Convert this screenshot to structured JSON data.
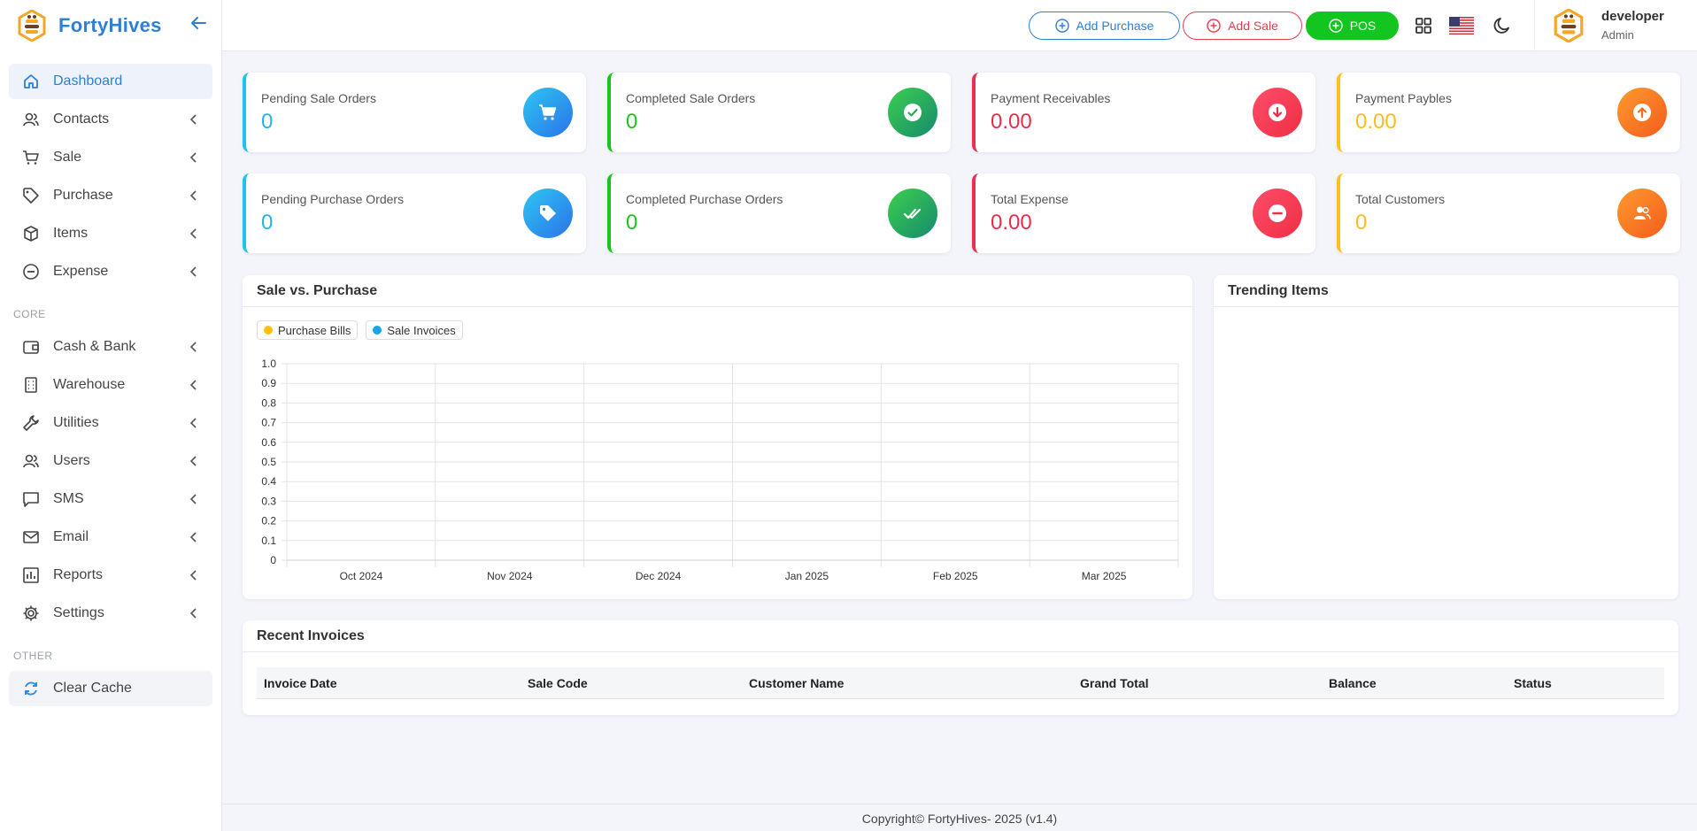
{
  "brand": {
    "name": "FortyHives"
  },
  "sidebar": {
    "items": [
      {
        "label": "Dashboard"
      },
      {
        "label": "Contacts"
      },
      {
        "label": "Sale"
      },
      {
        "label": "Purchase"
      },
      {
        "label": "Items"
      },
      {
        "label": "Expense"
      }
    ],
    "core_title": "CORE",
    "core_items": [
      {
        "label": "Cash & Bank"
      },
      {
        "label": "Warehouse"
      },
      {
        "label": "Utilities"
      },
      {
        "label": "Users"
      },
      {
        "label": "SMS"
      },
      {
        "label": "Email"
      },
      {
        "label": "Reports"
      },
      {
        "label": "Settings"
      }
    ],
    "other_title": "OTHER",
    "other_items": [
      {
        "label": "Clear Cache"
      }
    ]
  },
  "topbar": {
    "add_purchase": "Add Purchase",
    "add_sale": "Add Sale",
    "pos": "POS",
    "user_name": "developer",
    "user_role": "Admin"
  },
  "stats": [
    {
      "label": "Pending Sale Orders",
      "value": "0"
    },
    {
      "label": "Completed Sale Orders",
      "value": "0"
    },
    {
      "label": "Payment Receivables",
      "value": "0.00"
    },
    {
      "label": "Payment Paybles",
      "value": "0.00"
    },
    {
      "label": "Pending Purchase Orders",
      "value": "0"
    },
    {
      "label": "Completed Purchase Orders",
      "value": "0"
    },
    {
      "label": "Total Expense",
      "value": "0.00"
    },
    {
      "label": "Total Customers",
      "value": "0"
    }
  ],
  "chart_panel": {
    "title": "Sale vs. Purchase"
  },
  "trending_panel": {
    "title": "Trending Items"
  },
  "chart_data": {
    "type": "bar",
    "categories": [
      "Oct 2024",
      "Nov 2024",
      "Dec 2024",
      "Jan 2025",
      "Feb 2025",
      "Mar 2025"
    ],
    "series": [
      {
        "name": "Purchase Bills",
        "color": "#ffc107",
        "values": [
          0,
          0,
          0,
          0,
          0,
          0
        ]
      },
      {
        "name": "Sale Invoices",
        "color": "#1aa3e8",
        "values": [
          0,
          0,
          0,
          0,
          0,
          0
        ]
      }
    ],
    "ylim": [
      0,
      1
    ],
    "yticks": [
      "1.0",
      "0.9",
      "0.8",
      "0.7",
      "0.6",
      "0.5",
      "0.4",
      "0.3",
      "0.2",
      "0.1",
      "0"
    ],
    "grid": true,
    "legend": "top-left"
  },
  "invoices": {
    "title": "Recent Invoices",
    "columns": [
      "Invoice Date",
      "Sale Code",
      "Customer Name",
      "Grand Total",
      "Balance",
      "Status"
    ],
    "rows": []
  },
  "footer": {
    "text": "Copyright© FortyHives- 2025 (v1.4)"
  }
}
